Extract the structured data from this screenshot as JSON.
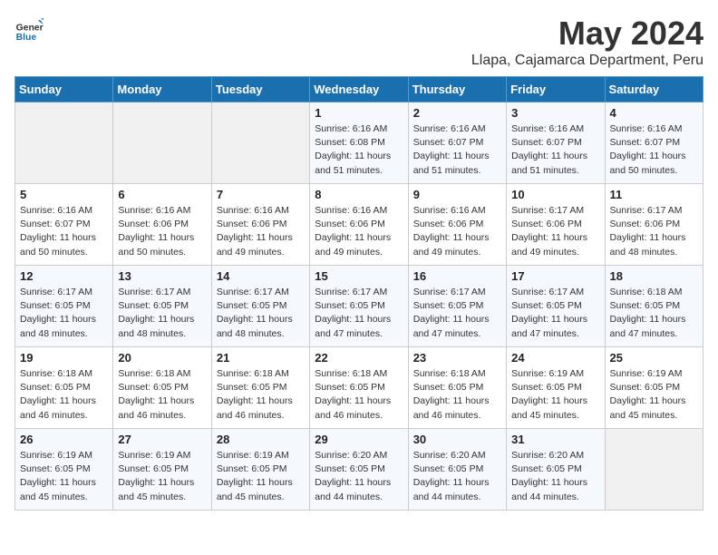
{
  "logo": {
    "general": "General",
    "blue": "Blue"
  },
  "title": "May 2024",
  "subtitle": "Llapa, Cajamarca Department, Peru",
  "weekdays": [
    "Sunday",
    "Monday",
    "Tuesday",
    "Wednesday",
    "Thursday",
    "Friday",
    "Saturday"
  ],
  "weeks": [
    [
      {
        "day": "",
        "info": ""
      },
      {
        "day": "",
        "info": ""
      },
      {
        "day": "",
        "info": ""
      },
      {
        "day": "1",
        "info": "Sunrise: 6:16 AM\nSunset: 6:08 PM\nDaylight: 11 hours\nand 51 minutes."
      },
      {
        "day": "2",
        "info": "Sunrise: 6:16 AM\nSunset: 6:07 PM\nDaylight: 11 hours\nand 51 minutes."
      },
      {
        "day": "3",
        "info": "Sunrise: 6:16 AM\nSunset: 6:07 PM\nDaylight: 11 hours\nand 51 minutes."
      },
      {
        "day": "4",
        "info": "Sunrise: 6:16 AM\nSunset: 6:07 PM\nDaylight: 11 hours\nand 50 minutes."
      }
    ],
    [
      {
        "day": "5",
        "info": "Sunrise: 6:16 AM\nSunset: 6:07 PM\nDaylight: 11 hours\nand 50 minutes."
      },
      {
        "day": "6",
        "info": "Sunrise: 6:16 AM\nSunset: 6:06 PM\nDaylight: 11 hours\nand 50 minutes."
      },
      {
        "day": "7",
        "info": "Sunrise: 6:16 AM\nSunset: 6:06 PM\nDaylight: 11 hours\nand 49 minutes."
      },
      {
        "day": "8",
        "info": "Sunrise: 6:16 AM\nSunset: 6:06 PM\nDaylight: 11 hours\nand 49 minutes."
      },
      {
        "day": "9",
        "info": "Sunrise: 6:16 AM\nSunset: 6:06 PM\nDaylight: 11 hours\nand 49 minutes."
      },
      {
        "day": "10",
        "info": "Sunrise: 6:17 AM\nSunset: 6:06 PM\nDaylight: 11 hours\nand 49 minutes."
      },
      {
        "day": "11",
        "info": "Sunrise: 6:17 AM\nSunset: 6:06 PM\nDaylight: 11 hours\nand 48 minutes."
      }
    ],
    [
      {
        "day": "12",
        "info": "Sunrise: 6:17 AM\nSunset: 6:05 PM\nDaylight: 11 hours\nand 48 minutes."
      },
      {
        "day": "13",
        "info": "Sunrise: 6:17 AM\nSunset: 6:05 PM\nDaylight: 11 hours\nand 48 minutes."
      },
      {
        "day": "14",
        "info": "Sunrise: 6:17 AM\nSunset: 6:05 PM\nDaylight: 11 hours\nand 48 minutes."
      },
      {
        "day": "15",
        "info": "Sunrise: 6:17 AM\nSunset: 6:05 PM\nDaylight: 11 hours\nand 47 minutes."
      },
      {
        "day": "16",
        "info": "Sunrise: 6:17 AM\nSunset: 6:05 PM\nDaylight: 11 hours\nand 47 minutes."
      },
      {
        "day": "17",
        "info": "Sunrise: 6:17 AM\nSunset: 6:05 PM\nDaylight: 11 hours\nand 47 minutes."
      },
      {
        "day": "18",
        "info": "Sunrise: 6:18 AM\nSunset: 6:05 PM\nDaylight: 11 hours\nand 47 minutes."
      }
    ],
    [
      {
        "day": "19",
        "info": "Sunrise: 6:18 AM\nSunset: 6:05 PM\nDaylight: 11 hours\nand 46 minutes."
      },
      {
        "day": "20",
        "info": "Sunrise: 6:18 AM\nSunset: 6:05 PM\nDaylight: 11 hours\nand 46 minutes."
      },
      {
        "day": "21",
        "info": "Sunrise: 6:18 AM\nSunset: 6:05 PM\nDaylight: 11 hours\nand 46 minutes."
      },
      {
        "day": "22",
        "info": "Sunrise: 6:18 AM\nSunset: 6:05 PM\nDaylight: 11 hours\nand 46 minutes."
      },
      {
        "day": "23",
        "info": "Sunrise: 6:18 AM\nSunset: 6:05 PM\nDaylight: 11 hours\nand 46 minutes."
      },
      {
        "day": "24",
        "info": "Sunrise: 6:19 AM\nSunset: 6:05 PM\nDaylight: 11 hours\nand 45 minutes."
      },
      {
        "day": "25",
        "info": "Sunrise: 6:19 AM\nSunset: 6:05 PM\nDaylight: 11 hours\nand 45 minutes."
      }
    ],
    [
      {
        "day": "26",
        "info": "Sunrise: 6:19 AM\nSunset: 6:05 PM\nDaylight: 11 hours\nand 45 minutes."
      },
      {
        "day": "27",
        "info": "Sunrise: 6:19 AM\nSunset: 6:05 PM\nDaylight: 11 hours\nand 45 minutes."
      },
      {
        "day": "28",
        "info": "Sunrise: 6:19 AM\nSunset: 6:05 PM\nDaylight: 11 hours\nand 45 minutes."
      },
      {
        "day": "29",
        "info": "Sunrise: 6:20 AM\nSunset: 6:05 PM\nDaylight: 11 hours\nand 44 minutes."
      },
      {
        "day": "30",
        "info": "Sunrise: 6:20 AM\nSunset: 6:05 PM\nDaylight: 11 hours\nand 44 minutes."
      },
      {
        "day": "31",
        "info": "Sunrise: 6:20 AM\nSunset: 6:05 PM\nDaylight: 11 hours\nand 44 minutes."
      },
      {
        "day": "",
        "info": ""
      }
    ]
  ]
}
